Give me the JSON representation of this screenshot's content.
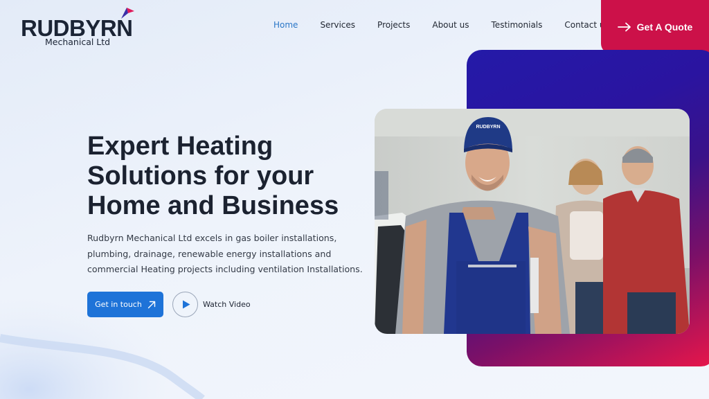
{
  "header": {
    "logo_word": "RUDBYRN",
    "logo_sub": "Mechanical Ltd",
    "nav": [
      "Home",
      "Services",
      "Projects",
      "About us",
      "Testimonials",
      "Contact us"
    ],
    "active_nav": "Home",
    "quote_label": "Get A Quote"
  },
  "hero": {
    "title_lines": [
      "Expert Heating",
      "Solutions for your",
      "Home and Business"
    ],
    "description": "Rudbyrn Mechanical Ltd excels in gas boiler installations, plumbing, drainage, renewable energy installations and commercial Heating projects including ventilation Installations.",
    "cta_label": "Get in touch",
    "video_label": "Watch Video"
  },
  "photo": {
    "cap_text": "RUDBYRN"
  },
  "colors": {
    "accent_red": "#cc1149",
    "button_blue": "#1e73d8",
    "nav_active": "#2a76c7",
    "text_dark": "#1b2230"
  },
  "icons": [
    "arrow-right-icon",
    "arrow-up-right-icon",
    "play-icon",
    "logo-mark-icon"
  ]
}
